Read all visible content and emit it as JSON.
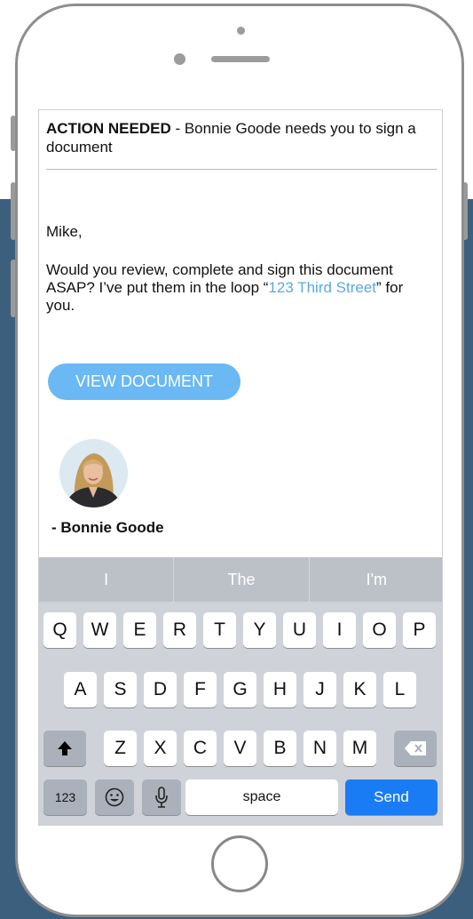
{
  "email": {
    "subject_bold": "ACTION NEEDED",
    "subject_rest": " -  Bonnie Goode needs you to sign a document",
    "greeting": "Mike,",
    "body_before_link": "Would you review, complete and sign this document ASAP? I’ve put them in the loop “",
    "link_text": "123 Third Street",
    "body_after_link": "” for you.",
    "button_label": "VIEW DOCUMENT",
    "signature": "- Bonnie Goode"
  },
  "keyboard": {
    "suggestions": [
      "I",
      "The",
      "I'm"
    ],
    "row1": [
      "Q",
      "W",
      "E",
      "R",
      "T",
      "Y",
      "U",
      "I",
      "O",
      "P"
    ],
    "row2": [
      "A",
      "S",
      "D",
      "F",
      "G",
      "H",
      "J",
      "K",
      "L"
    ],
    "row3": [
      "Z",
      "X",
      "C",
      "V",
      "B",
      "N",
      "M"
    ],
    "numbers_label": "123",
    "space_label": "space",
    "send_label": "Send"
  },
  "colors": {
    "background_band": "#3d5f7e",
    "link": "#5aa9e6",
    "button": "#6ab8f4",
    "send_key": "#1a7cf5"
  }
}
